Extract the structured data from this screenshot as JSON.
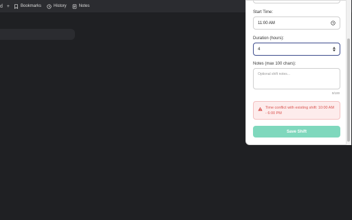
{
  "toolbar": {
    "partial_item": "d",
    "plus": "+",
    "items": [
      {
        "label": "Bookmarks",
        "icon": "bookmark-icon"
      },
      {
        "label": "History",
        "icon": "history-icon"
      },
      {
        "label": "Notes",
        "icon": "notes-icon"
      }
    ]
  },
  "form": {
    "start_time_label": "Start Time:",
    "start_time_value": "11:00 AM",
    "duration_label": "Duration (hours):",
    "duration_value": "4",
    "notes_label": "Notes (max 100 chars):",
    "notes_placeholder": "Optional shift notes...",
    "notes_counter": "0/100",
    "error_message": "Time conflict with existing shift: 10:00 AM - 6:00 PM",
    "save_label": "Save Shift"
  },
  "colors": {
    "save_button": "#7fd8bd",
    "error_text": "#d9534f",
    "error_background": "#fdecec",
    "focus_border": "#3b4a8c"
  }
}
